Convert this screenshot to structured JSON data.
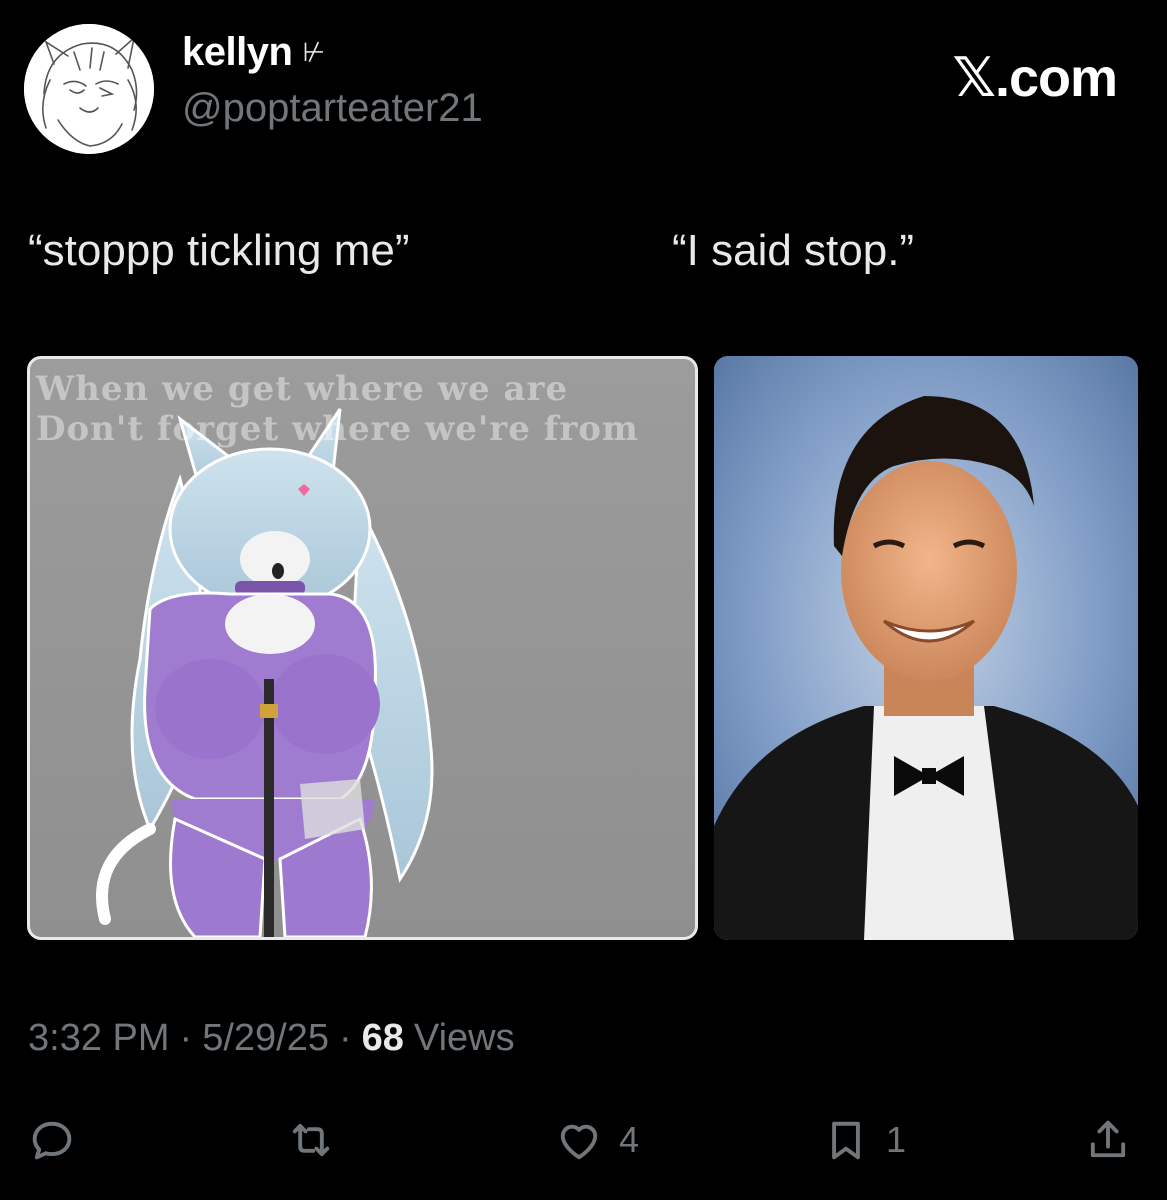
{
  "author": {
    "display_name": "kellyn",
    "pronoun_glyph": "⊬",
    "handle": "@poptarteater21"
  },
  "site_label": "𝕏.com",
  "captions": {
    "left": "“stoppp tickling me”",
    "right": "“I said stop.”"
  },
  "media_left": {
    "overlay_line_1": "When we get where we are",
    "overlay_line_2": "Don't forget where we're from",
    "description_icon": "anime-catgirl-drawing"
  },
  "media_right": {
    "description_icon": "yearbook-portrait-photo"
  },
  "meta": {
    "time": "3:32 PM",
    "sep1": "·",
    "date": "5/29/25",
    "sep2": "·",
    "views_count": "68",
    "views_label": "Views"
  },
  "actions": {
    "reply_count": "",
    "repost_count": "",
    "like_count": "4",
    "bookmark_count": "1"
  },
  "colors": {
    "background": "#000000",
    "secondary_text": "#71767b",
    "primary_text": "#e7e9ea"
  }
}
